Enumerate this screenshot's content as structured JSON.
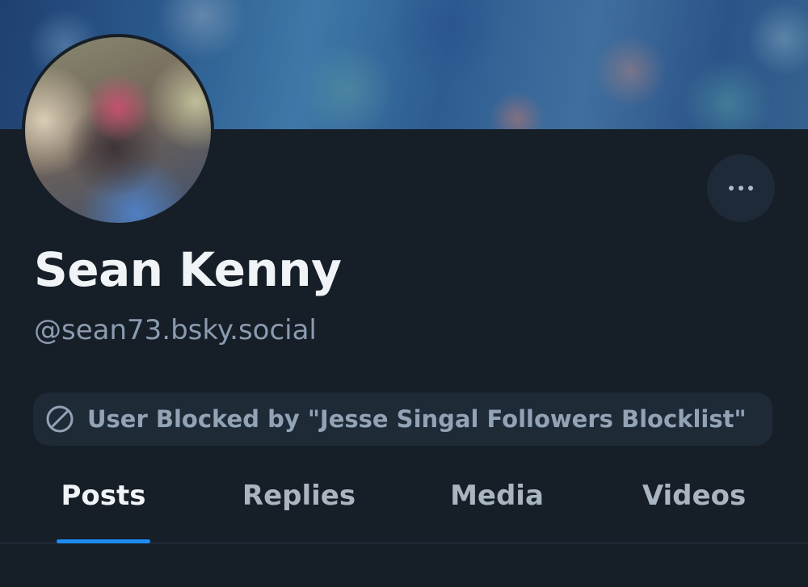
{
  "profile": {
    "display_name": "Sean Kenny",
    "handle": "@sean73.bsky.social",
    "banner_description": "blurred banner image",
    "avatar_description": "blurred profile photo"
  },
  "actions": {
    "more_icon": "ellipsis-icon"
  },
  "moderation": {
    "icon": "block-icon",
    "label": "User Blocked by \"Jesse Singal Followers Blocklist\""
  },
  "tabs": [
    {
      "label": "Posts",
      "active": true
    },
    {
      "label": "Replies",
      "active": false
    },
    {
      "label": "Media",
      "active": false
    },
    {
      "label": "Videos",
      "active": false
    }
  ],
  "colors": {
    "background": "#161e27",
    "accent": "#1d8cf5",
    "muted_text": "#8b9bb0",
    "pill_background": "#1f2a37"
  }
}
